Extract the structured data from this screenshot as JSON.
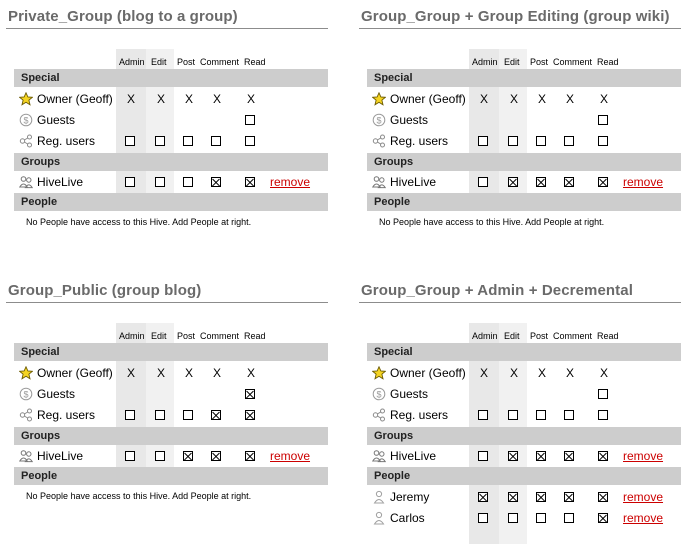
{
  "columns": [
    "Admin",
    "Edit",
    "Post",
    "Comment",
    "Read"
  ],
  "sections": {
    "special": "Special",
    "groups": "Groups",
    "people": "People"
  },
  "remove_label": "remove",
  "no_people_text": "No People have access to this Hive. Add People at right.",
  "panels": [
    {
      "title": "Private_Group (blog to a group)",
      "special": [
        {
          "label": "Owner (Geoff)",
          "icon": "star-icon",
          "cells": [
            "X",
            "X",
            "X",
            "X",
            "X"
          ]
        },
        {
          "label": "Guests",
          "icon": "guest-icon",
          "cells": [
            "",
            "",
            "",
            "",
            "box"
          ]
        },
        {
          "label": "Reg. users",
          "icon": "network-icon",
          "cells": [
            "box",
            "box",
            "box",
            "box",
            "box"
          ]
        }
      ],
      "groups": [
        {
          "label": "HiveLive",
          "icon": "group-icon",
          "cells": [
            "box",
            "box",
            "box",
            "checked",
            "checked"
          ]
        }
      ],
      "people": []
    },
    {
      "title": "Group_Group + Group Editing (group wiki)",
      "special": [
        {
          "label": "Owner (Geoff)",
          "icon": "star-icon",
          "cells": [
            "X",
            "X",
            "X",
            "X",
            "X"
          ]
        },
        {
          "label": "Guests",
          "icon": "guest-icon",
          "cells": [
            "",
            "",
            "",
            "",
            "box"
          ]
        },
        {
          "label": "Reg. users",
          "icon": "network-icon",
          "cells": [
            "box",
            "box",
            "box",
            "box",
            "box"
          ]
        }
      ],
      "groups": [
        {
          "label": "HiveLive",
          "icon": "group-icon",
          "cells": [
            "box",
            "checked",
            "checked",
            "checked",
            "checked"
          ]
        }
      ],
      "people": []
    },
    {
      "title": "Group_Public (group blog)",
      "special": [
        {
          "label": "Owner (Geoff)",
          "icon": "star-icon",
          "cells": [
            "X",
            "X",
            "X",
            "X",
            "X"
          ]
        },
        {
          "label": "Guests",
          "icon": "guest-icon",
          "cells": [
            "",
            "",
            "",
            "",
            "checked"
          ]
        },
        {
          "label": "Reg. users",
          "icon": "network-icon",
          "cells": [
            "box",
            "box",
            "box",
            "checked",
            "checked"
          ]
        }
      ],
      "groups": [
        {
          "label": "HiveLive",
          "icon": "group-icon",
          "cells": [
            "box",
            "box",
            "checked",
            "checked",
            "checked"
          ]
        }
      ],
      "people": []
    },
    {
      "title": "Group_Group + Admin + Decremental",
      "special": [
        {
          "label": "Owner (Geoff)",
          "icon": "star-icon",
          "cells": [
            "X",
            "X",
            "X",
            "X",
            "X"
          ]
        },
        {
          "label": "Guests",
          "icon": "guest-icon",
          "cells": [
            "",
            "",
            "",
            "",
            "box"
          ]
        },
        {
          "label": "Reg. users",
          "icon": "network-icon",
          "cells": [
            "box",
            "box",
            "box",
            "box",
            "box"
          ]
        }
      ],
      "groups": [
        {
          "label": "HiveLive",
          "icon": "group-icon",
          "cells": [
            "box",
            "checked",
            "checked",
            "checked",
            "checked"
          ]
        }
      ],
      "people": [
        {
          "label": "Jeremy",
          "icon": "person-icon",
          "cells": [
            "checked",
            "checked",
            "checked",
            "checked",
            "checked"
          ]
        },
        {
          "label": "Carlos",
          "icon": "person-icon",
          "cells": [
            "box",
            "box",
            "box",
            "box",
            "checked"
          ]
        }
      ]
    }
  ]
}
